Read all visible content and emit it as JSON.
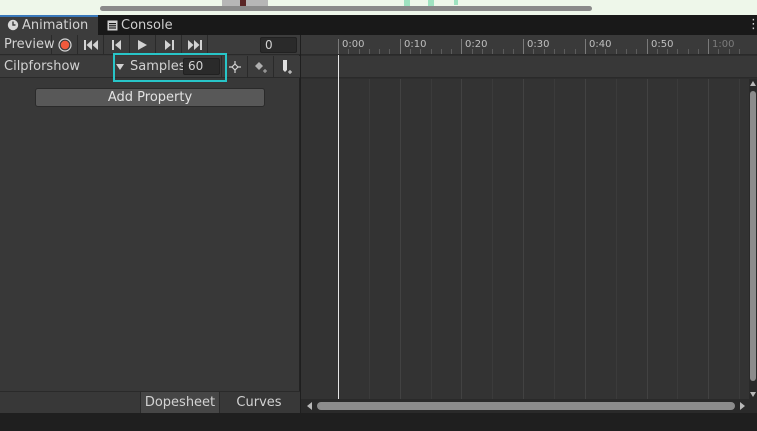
{
  "tabs": [
    {
      "label": "Animation",
      "icon": "clock-icon",
      "active": true
    },
    {
      "label": "Console",
      "icon": "console-icon",
      "active": false
    }
  ],
  "toolbar": {
    "preview_label": "Preview",
    "record_icon": "record-icon",
    "record_color": "#f05a3c",
    "frame_value": "0"
  },
  "clip": {
    "name": "Cilpforshow",
    "samples_label": "Samples",
    "samples_value": "60"
  },
  "add_property_label": "Add Property",
  "view_tabs": {
    "dopesheet": "Dopesheet",
    "curves": "Curves"
  },
  "timeline": {
    "ticks": [
      "0:00",
      "0:10",
      "0:20",
      "0:30",
      "0:40",
      "0:50",
      "1:00"
    ]
  },
  "colors": {
    "accent_tab": "#3a79bb",
    "highlight": "#28c5c8",
    "playhead": "#e6e6e6"
  }
}
